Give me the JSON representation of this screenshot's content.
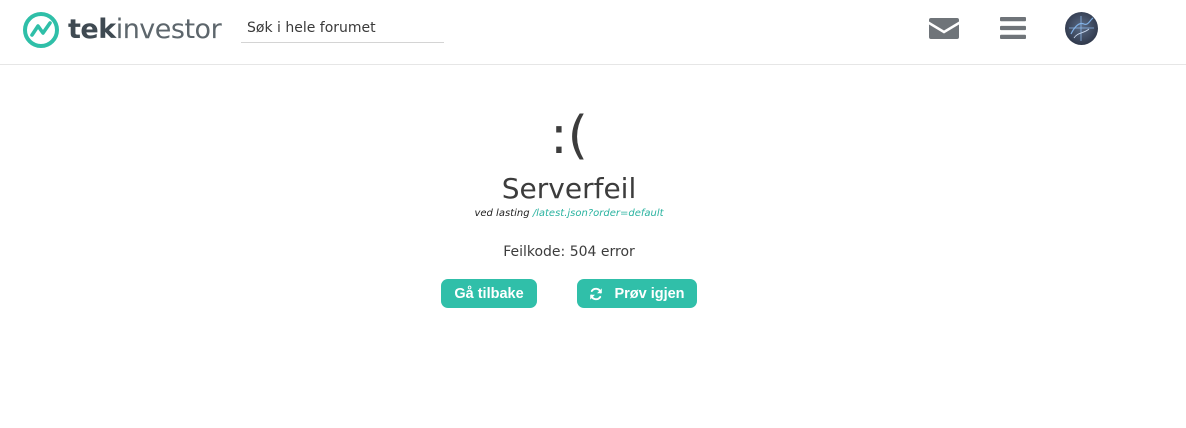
{
  "header": {
    "logo": {
      "text_bold": "tek",
      "text_light": "investor"
    },
    "search": {
      "placeholder": "Søk i hele forumet",
      "value": ""
    },
    "icons": [
      "envelope-icon",
      "hamburger-menu-icon",
      "user-avatar"
    ]
  },
  "error": {
    "face": ":(",
    "title": "Serverfeil",
    "subtitle_prefix": "ved lasting",
    "subtitle_path": "/latest.json?order=default",
    "code_label": "Feilkode:",
    "code_value": "504 error"
  },
  "buttons": {
    "back_label": "Gå tilbake",
    "retry_label": "Prøv igjen",
    "retry_icon": "refresh-icon"
  },
  "colors": {
    "accent": "#30bfa9",
    "logo_ring": "#2fbfa8",
    "link": "#2ab3a0",
    "icon_gray": "#6f7479"
  }
}
